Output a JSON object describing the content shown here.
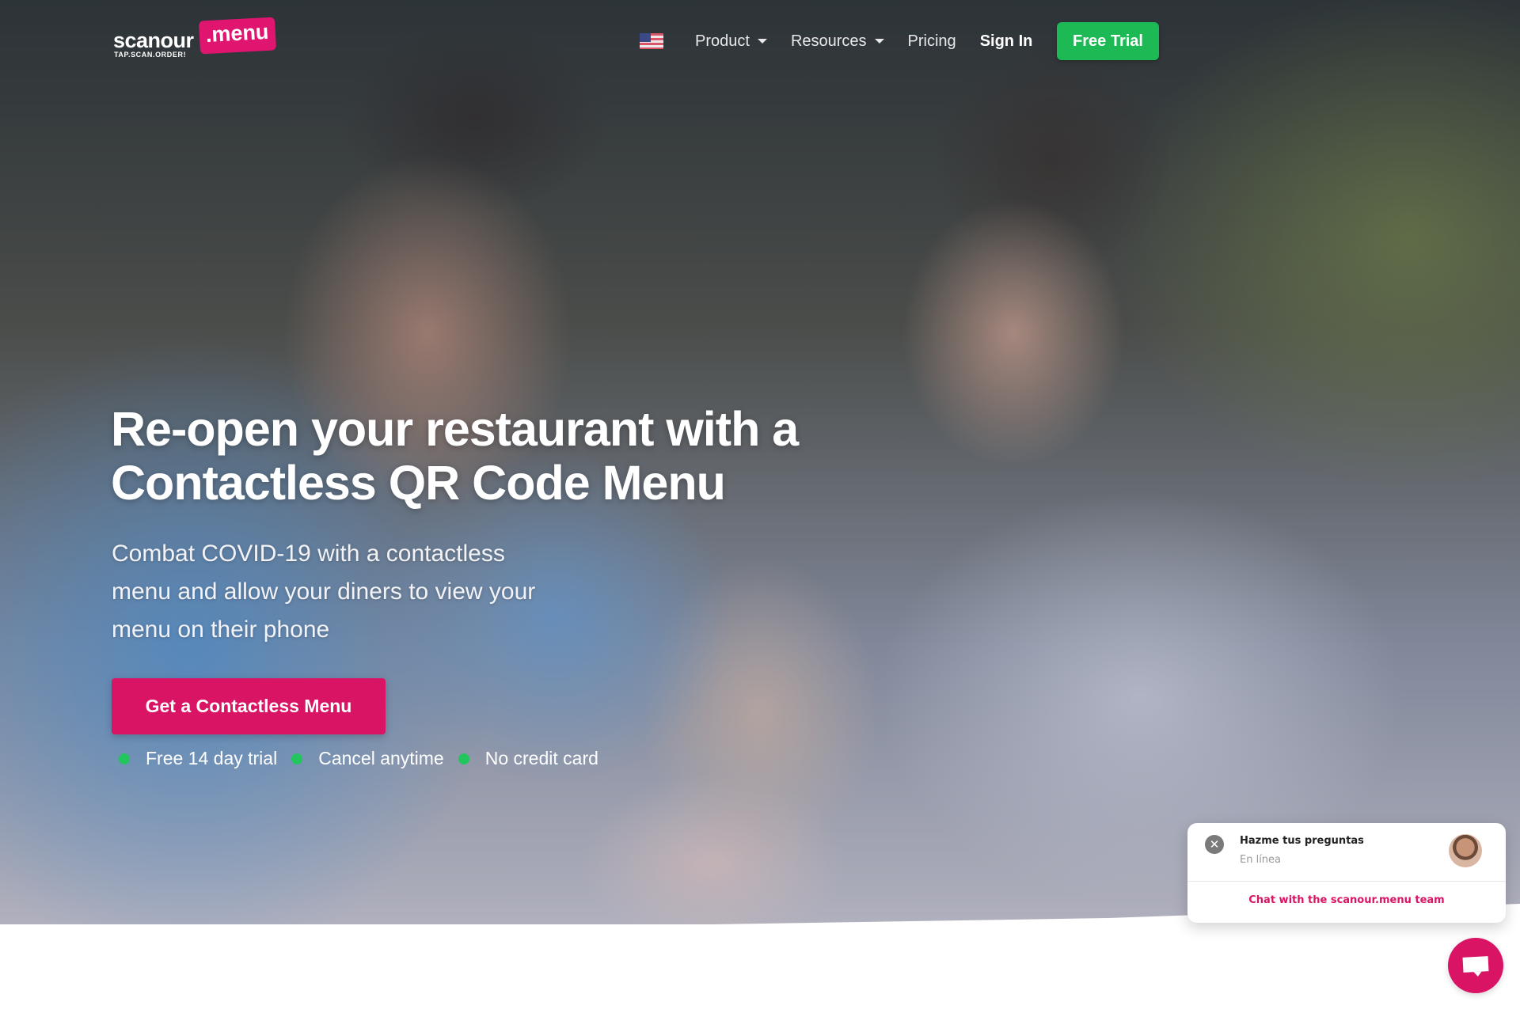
{
  "brand": {
    "name": "scanour",
    "badge": ".menu",
    "tagline": "TAP.SCAN.ORDER!",
    "accent": "#d91464",
    "green": "#1db954"
  },
  "nav": {
    "language_icon": "us-flag-icon",
    "items": [
      {
        "label": "Product",
        "dropdown": true
      },
      {
        "label": "Resources",
        "dropdown": true
      },
      {
        "label": "Pricing",
        "dropdown": false
      },
      {
        "label": "Sign In",
        "dropdown": false
      }
    ],
    "cta": "Free Trial"
  },
  "hero": {
    "headline_line1": "Re-open your restaurant with a",
    "headline_line2": "Contactless QR Code Menu",
    "subtitle_line1": "Combat COVID-19 with a contactless",
    "subtitle_line2": "menu and allow your diners to view your",
    "subtitle_line3": "menu on their phone",
    "cta": "Get a Contactless Menu",
    "perks": [
      "Free 14 day trial",
      "Cancel anytime",
      "No credit card"
    ]
  },
  "chat": {
    "title": "Hazme tus preguntas",
    "status": "En línea",
    "link": "Chat with the scanour.menu team",
    "close_icon": "close-icon",
    "fab_icon": "chat-bubble-icon"
  }
}
